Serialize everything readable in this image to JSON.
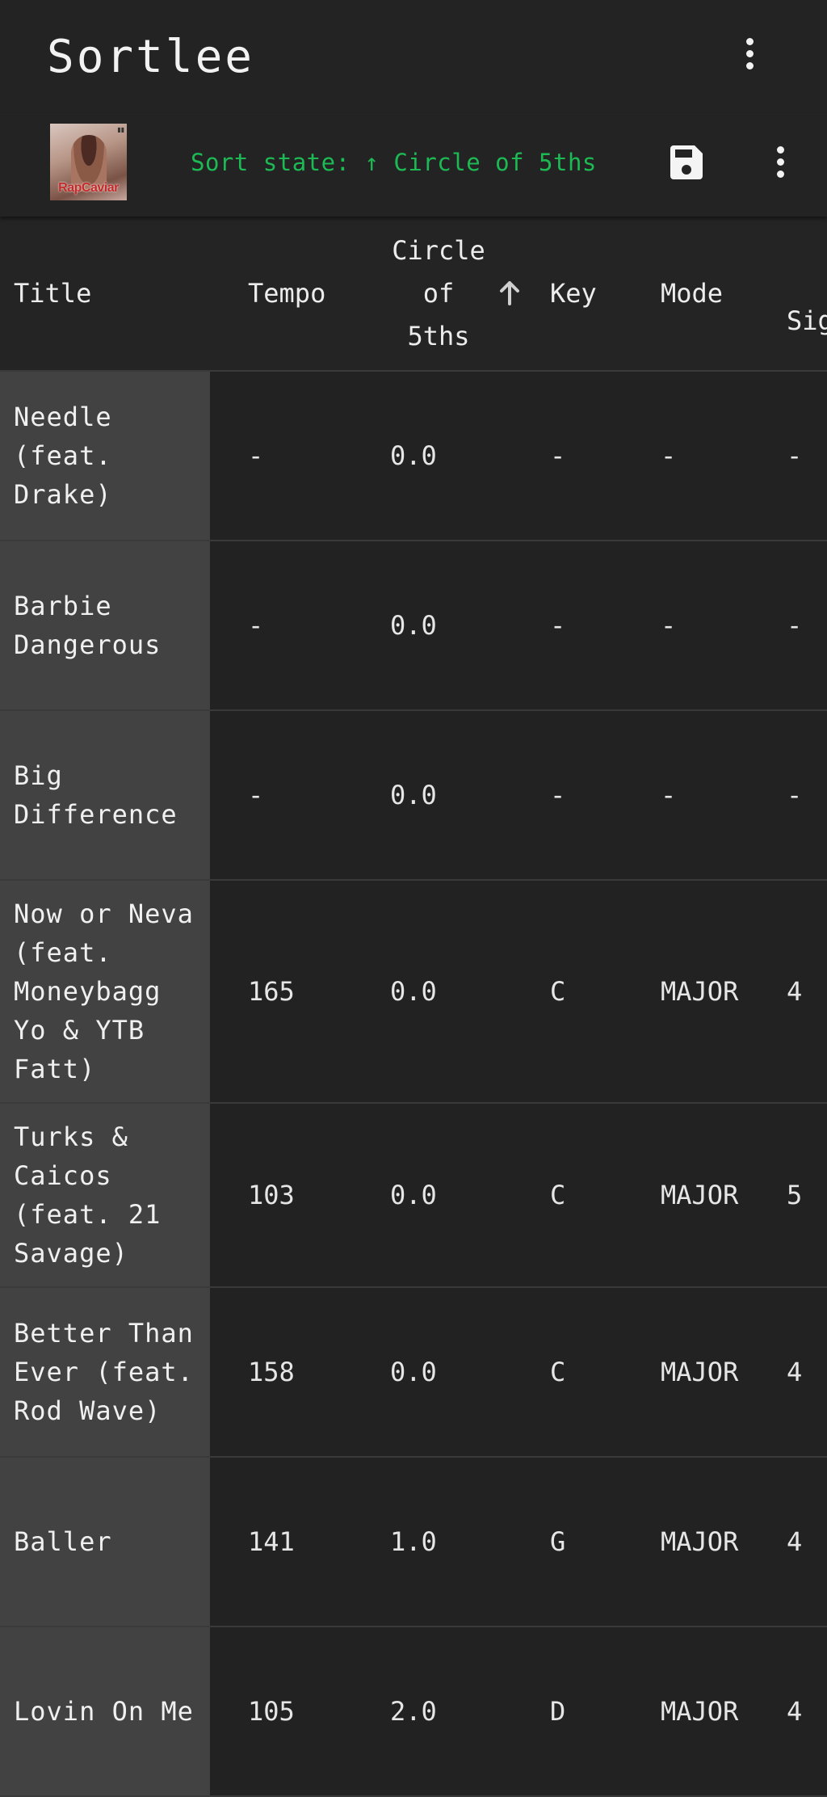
{
  "app": {
    "title": "Sortlee"
  },
  "toolbar": {
    "playlist_cover_text": "RapCaviar",
    "sort_state": "Sort state: ↑ Circle of 5ths"
  },
  "table": {
    "headers": {
      "title": "Title",
      "tempo": "Tempo",
      "circle_line1": "Circle",
      "circle_line2": "of",
      "circle_line3": "5ths",
      "key": "Key",
      "mode": "Mode",
      "signature": "Sig"
    },
    "rows": [
      {
        "title": "Needle (feat. Drake)",
        "tempo": "-",
        "circle": "0.0",
        "key": "-",
        "mode": "-",
        "sig": "-"
      },
      {
        "title": "Barbie Dangerous",
        "tempo": "-",
        "circle": "0.0",
        "key": "-",
        "mode": "-",
        "sig": "-"
      },
      {
        "title": "Big Difference",
        "tempo": "-",
        "circle": "0.0",
        "key": "-",
        "mode": "-",
        "sig": "-"
      },
      {
        "title": "Now or Neva (feat. Moneybagg Yo & YTB Fatt)",
        "tempo": "165",
        "circle": "0.0",
        "key": "C",
        "mode": "MAJOR",
        "sig": "4"
      },
      {
        "title": "Turks & Caicos (feat. 21 Savage)",
        "tempo": "103",
        "circle": "0.0",
        "key": "C",
        "mode": "MAJOR",
        "sig": "5"
      },
      {
        "title": "Better Than Ever (feat. Rod Wave)",
        "tempo": "158",
        "circle": "0.0",
        "key": "C",
        "mode": "MAJOR",
        "sig": "4"
      },
      {
        "title": "Baller",
        "tempo": "141",
        "circle": "1.0",
        "key": "G",
        "mode": "MAJOR",
        "sig": "4"
      },
      {
        "title": "Lovin On Me",
        "tempo": "105",
        "circle": "2.0",
        "key": "D",
        "mode": "MAJOR",
        "sig": "4"
      }
    ]
  },
  "colors": {
    "background": "#222222",
    "title_column": "#424242",
    "sort_state_accent": "#1db954"
  }
}
